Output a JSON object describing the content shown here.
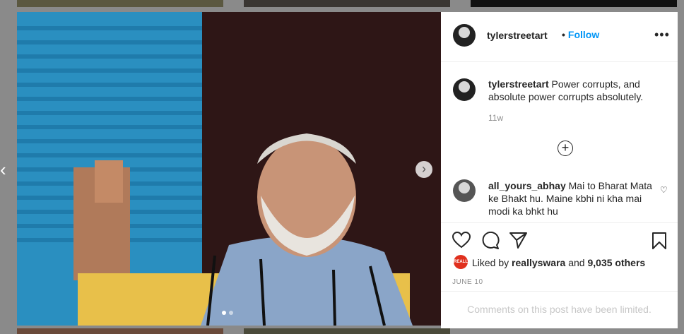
{
  "post": {
    "username": "tylerstreetart",
    "follow_label": "Follow",
    "separator": "•",
    "more_label": "•••",
    "caption_text": "Power corrupts, and absolute power corrupts absolutely.",
    "age": "11w"
  },
  "comments": [
    {
      "username": "all_yours_abhay",
      "text": "Mai to Bharat Mata ke Bhakt hu. Maine kbhi ni kha mai modi ka bhkt hu"
    }
  ],
  "likes": {
    "prefix": "Liked by",
    "user": "reallyswara",
    "connector": "and",
    "count": "9,035 others",
    "avatar_text": "REALLY"
  },
  "date": "JUNE 10",
  "comments_notice": "Comments on this post have been limited.",
  "carousel": {
    "left_arrow": "‹",
    "right_arrow": "›",
    "slides": 2,
    "active": 0
  },
  "colors": {
    "link": "#0095f6",
    "text": "#262626",
    "muted": "#8e8e8e"
  }
}
